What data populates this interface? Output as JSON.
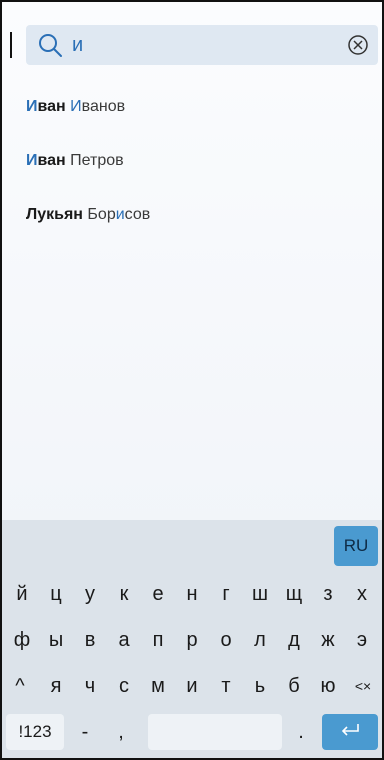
{
  "search": {
    "query": "и",
    "placeholder": "",
    "icon": "search-icon",
    "clear_icon": "clear-icon"
  },
  "results": [
    {
      "first_hl": "И",
      "first_rest": "ван",
      "last_hl": "И",
      "last_rest": "ванов"
    },
    {
      "first_hl": "И",
      "first_rest": "ван",
      "last_text": "Петров"
    },
    {
      "first_text": "Лукьян",
      "last_pre": "Бор",
      "last_hl": "и",
      "last_post": "сов"
    }
  ],
  "keyboard": {
    "language": "RU",
    "row1": [
      "й",
      "ц",
      "у",
      "к",
      "е",
      "н",
      "г",
      "ш",
      "щ",
      "з",
      "х"
    ],
    "row2": [
      "ф",
      "ы",
      "в",
      "а",
      "п",
      "р",
      "о",
      "л",
      "д",
      "ж",
      "э"
    ],
    "row3_shift": "^",
    "row3": [
      "я",
      "ч",
      "с",
      "м",
      "и",
      "т",
      "ь",
      "б",
      "ю"
    ],
    "row3_backspace": "<×",
    "row4": {
      "numbers": "!123",
      "dash": "-",
      "comma": ",",
      "space": "",
      "dot": ".",
      "enter_icon": "enter-icon"
    }
  },
  "colors": {
    "accent": "#2a6fb6",
    "search_bg": "#dfe8f2",
    "key_accent": "#4a9ad0",
    "keyboard_bg": "#dce3ea"
  }
}
